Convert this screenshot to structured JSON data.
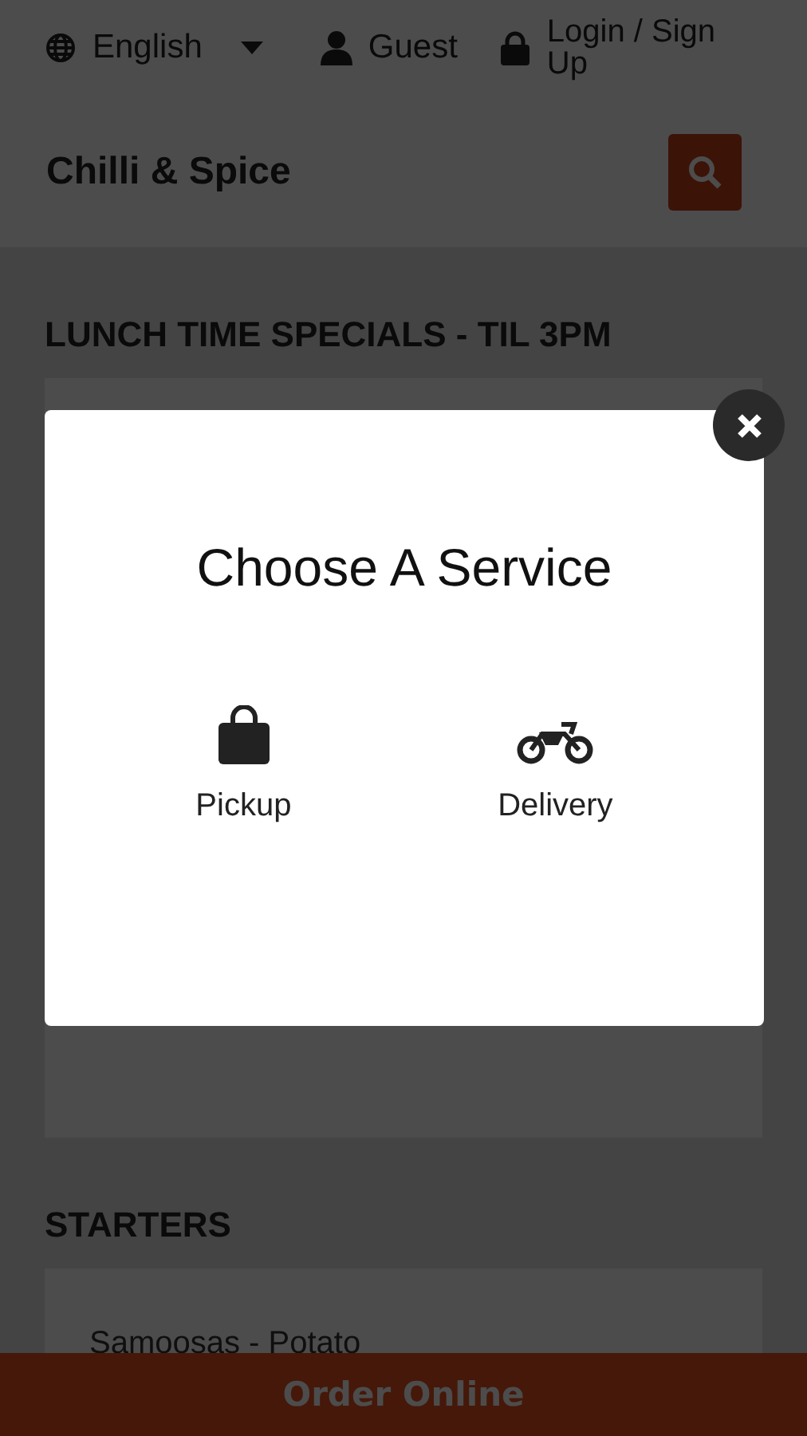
{
  "top_bar": {
    "language": "English",
    "user": "Guest",
    "login": "Login / Sign Up"
  },
  "header": {
    "title": "Chilli & Spice"
  },
  "sections": [
    {
      "title": "LUNCH TIME SPECIALS - TIL 3PM"
    },
    {
      "title": "STARTERS",
      "items": [
        "Samoosas - Potato"
      ]
    }
  ],
  "modal": {
    "title": "Choose A Service",
    "options": [
      {
        "kind": "pickup",
        "label": "Pickup"
      },
      {
        "kind": "delivery",
        "label": "Delivery"
      }
    ]
  },
  "order_button": "Order Online"
}
